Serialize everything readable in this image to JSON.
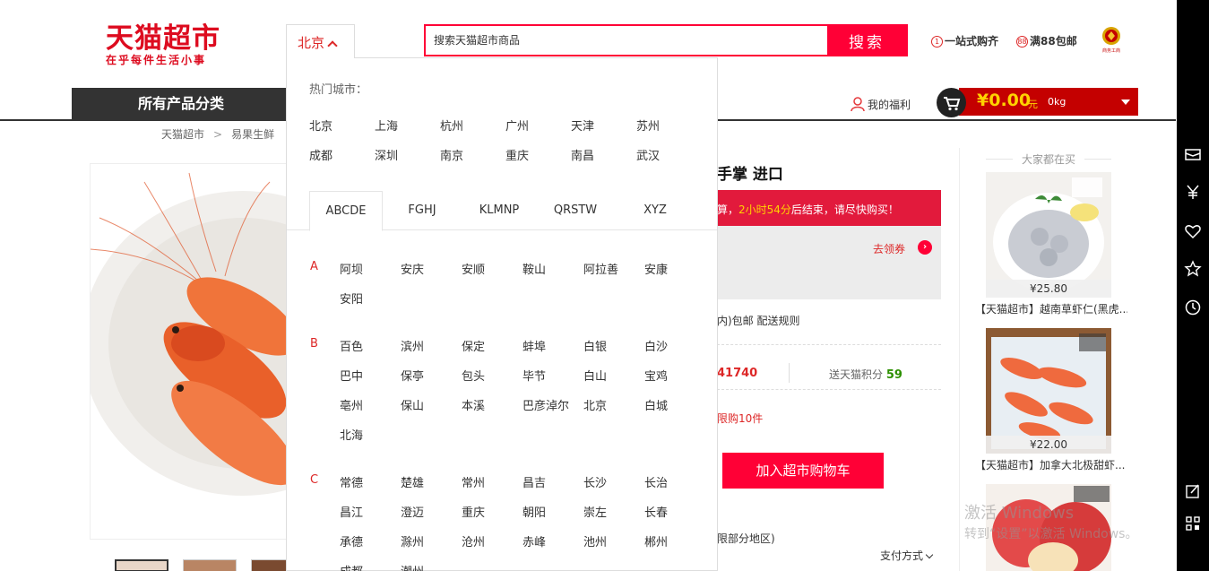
{
  "header": {
    "logo_title": "天猫超市",
    "logo_slogan": "在乎每件生活小事",
    "city_selector": "北京",
    "search_placeholder": "搜索天猫超市商品",
    "search_button": "搜索",
    "promo1_num": "1",
    "promo1": "一站式购齐",
    "promo2_num": "88",
    "promo2": "满88包邮",
    "badge_text": "商务工商",
    "category_nav": "所有产品分类",
    "welfare": "我的福利",
    "cart_amount": "¥0.00",
    "cart_unit": "元",
    "cart_weight": "0kg"
  },
  "breadcrumb": [
    "天猫超市",
    "易果生鲜"
  ],
  "city_dropdown": {
    "hot_title": "热门城市：",
    "hot_cities": [
      "北京",
      "上海",
      "杭州",
      "广州",
      "天津",
      "苏州",
      "成都",
      "深圳",
      "南京",
      "重庆",
      "南昌",
      "武汉"
    ],
    "tabs": [
      "ABCDE",
      "FGHJ",
      "KLMNP",
      "QRSTW",
      "XYZ"
    ],
    "active_tab": "ABCDE",
    "groups": [
      {
        "letter": "A",
        "cities": [
          "阿坝",
          "安庆",
          "安顺",
          "鞍山",
          "阿拉善",
          "安康",
          "安阳"
        ]
      },
      {
        "letter": "B",
        "cities": [
          "百色",
          "滨州",
          "保定",
          "蚌埠",
          "白银",
          "白沙",
          "巴中",
          "保亭",
          "包头",
          "毕节",
          "白山",
          "宝鸡",
          "亳州",
          "保山",
          "本溪",
          "巴彦淖尔",
          "北京",
          "白城",
          "北海"
        ]
      },
      {
        "letter": "C",
        "cities": [
          "常德",
          "楚雄",
          "常州",
          "昌吉",
          "长沙",
          "长治",
          "昌江",
          "澄迈",
          "重庆",
          "朝阳",
          "崇左",
          "长春",
          "承德",
          "滁州",
          "沧州",
          "赤峰",
          "池州",
          "郴州",
          "成都",
          "潮州"
        ]
      }
    ]
  },
  "product": {
    "title_fragment": "手掌 进口",
    "countdown_pre": "算，",
    "countdown_time": "2小时54分",
    "countdown_post": "后结束，请尽快购买！",
    "coupon": "去领券",
    "coupon_arrow": "›",
    "shipping": "内)包邮  配送规则",
    "sales": "41740",
    "points_label": "送天猫积分",
    "points_value": "59",
    "limit": "限购10件",
    "add_cart": "加入超市购物车",
    "area_note": "限部分地区)",
    "pay_method": "支付方式"
  },
  "recommend": {
    "title": "大家都在买",
    "items": [
      {
        "price": "¥25.80",
        "name": "【天猫超市】越南草虾仁(黑虎..."
      },
      {
        "price": "¥22.00",
        "name": "【天猫超市】加拿大北极甜虾..."
      }
    ]
  },
  "watermark": {
    "line1": "激活 Windows",
    "line2": "转到“设置”以激活 Windows。"
  },
  "sidebar_icons": [
    "card-icon",
    "yen-icon",
    "heart-icon",
    "star-icon",
    "history-icon",
    "edit-icon",
    "qrcode-icon"
  ]
}
